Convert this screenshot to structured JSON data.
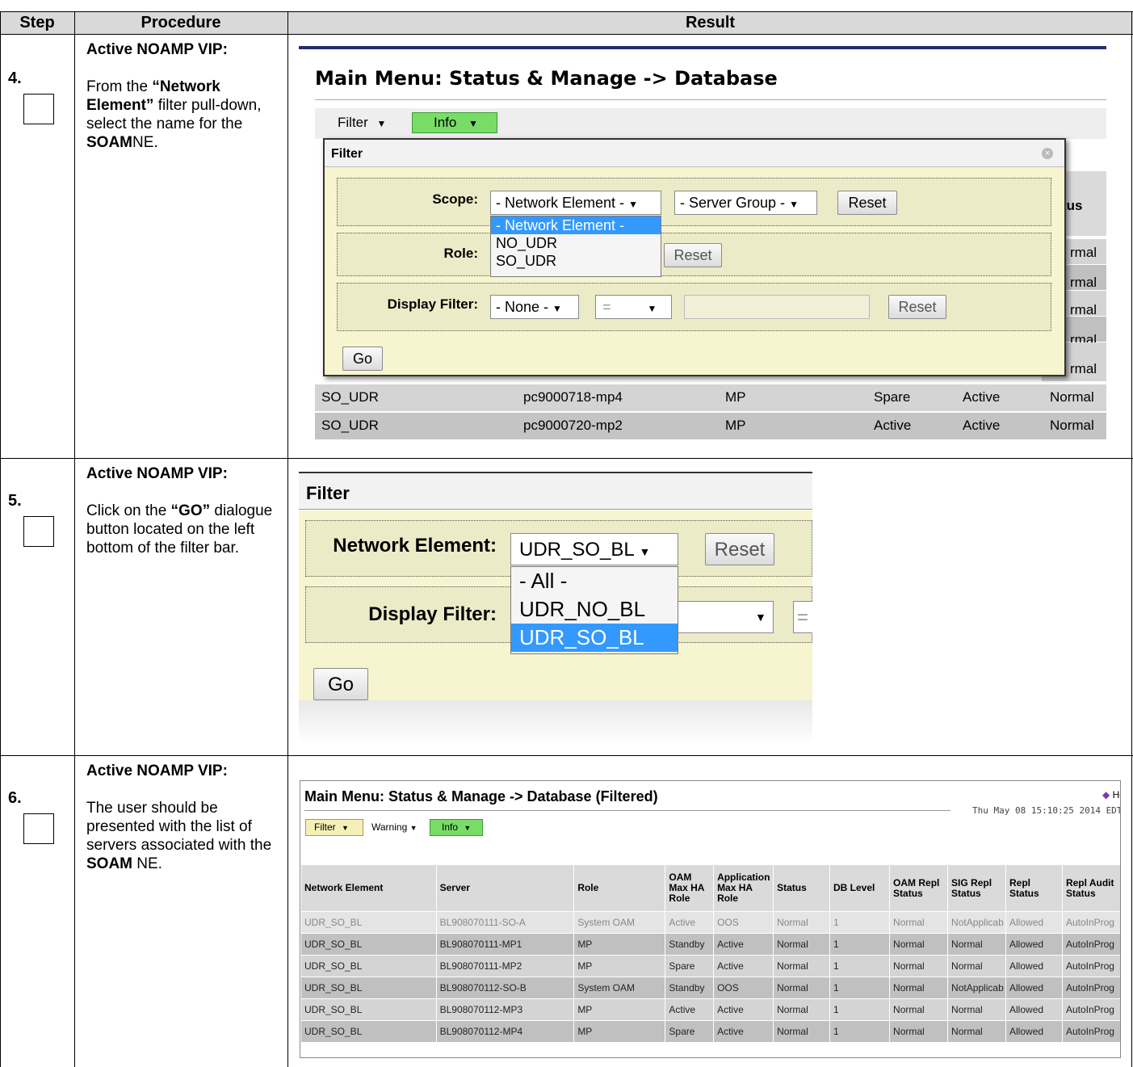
{
  "header": {
    "step": "Step",
    "procedure": "Procedure",
    "result": "Result"
  },
  "steps": [
    {
      "number": "4.",
      "role": "Active NOAMP VIP:",
      "desc_parts": [
        "From the ",
        "“Network Element”",
        " filter pull-down, select the name for the ",
        "SOAM",
        "NE."
      ]
    },
    {
      "number": "5.",
      "role": "Active NOAMP VIP:",
      "desc_parts": [
        "Click on the ",
        "“GO”",
        " dialogue button located on the left bottom of the filter bar."
      ]
    },
    {
      "number": "6.",
      "role": "Active NOAMP VIP:",
      "desc_parts": [
        "The user should be presented with the list of servers associated with the ",
        "SOAM",
        " NE."
      ]
    }
  ],
  "shot1": {
    "title": "Main Menu: Status & Manage -> Database",
    "filter_label": "Filter",
    "info_label": "Info",
    "dialog_title": "Filter",
    "scope_label": "Scope:",
    "ne_select": "- Network Element -",
    "sg_select": "- Server Group -",
    "reset": "Reset",
    "dropdown": [
      "- Network Element -",
      "NO_UDR",
      "SO_UDR"
    ],
    "role_label": "Role:",
    "display_filter_label": "Display Filter:",
    "none_select": "- None -",
    "eq_select": "=",
    "go": "Go",
    "status_fragment": "tus",
    "normal_fragments": [
      "rmal",
      "rmal",
      "rmal",
      "rmal",
      "rmal"
    ],
    "rows": [
      [
        "SO_UDR",
        "pc9000718-mp4",
        "MP",
        "Spare",
        "Active",
        "Normal"
      ],
      [
        "SO_UDR",
        "pc9000720-mp2",
        "MP",
        "Active",
        "Active",
        "Normal"
      ]
    ]
  },
  "shot2": {
    "title": "Filter",
    "ne_label": "Network Element:",
    "ne_value": "UDR_SO_BL",
    "reset": "Reset",
    "dropdown": [
      "- All -",
      "UDR_NO_BL",
      "UDR_SO_BL"
    ],
    "display_filter_label": "Display Filter:",
    "eq_fragment": "=",
    "go": "Go"
  },
  "shot3": {
    "title": "Main Menu: Status & Manage -> Database (Filtered)",
    "help": "Help",
    "timestamp": "Thu May 08 15:10:25 2014 EDT",
    "filter": "Filter",
    "warning": "Warning",
    "info": "Info",
    "columns": [
      "Network Element",
      "Server",
      "Role",
      "OAM Max HA Role",
      "Application Max HA Role",
      "Status",
      "DB Level",
      "OAM Repl Status",
      "SIG Repl Status",
      "Repl Status",
      "Repl Audit Status"
    ],
    "rows": [
      [
        "UDR_SO_BL",
        "BL908070111-SO-A",
        "System OAM",
        "Active",
        "OOS",
        "Normal",
        "1",
        "Normal",
        "NotApplicab",
        "Allowed",
        "AutoInProg"
      ],
      [
        "UDR_SO_BL",
        "BL908070111-MP1",
        "MP",
        "Standby",
        "Active",
        "Normal",
        "1",
        "Normal",
        "Normal",
        "Allowed",
        "AutoInProg"
      ],
      [
        "UDR_SO_BL",
        "BL908070111-MP2",
        "MP",
        "Spare",
        "Active",
        "Normal",
        "1",
        "Normal",
        "Normal",
        "Allowed",
        "AutoInProg"
      ],
      [
        "UDR_SO_BL",
        "BL908070112-SO-B",
        "System OAM",
        "Standby",
        "OOS",
        "Normal",
        "1",
        "Normal",
        "NotApplicab",
        "Allowed",
        "AutoInProg"
      ],
      [
        "UDR_SO_BL",
        "BL908070112-MP3",
        "MP",
        "Active",
        "Active",
        "Normal",
        "1",
        "Normal",
        "Normal",
        "Allowed",
        "AutoInProg"
      ],
      [
        "UDR_SO_BL",
        "BL908070112-MP4",
        "MP",
        "Spare",
        "Active",
        "Normal",
        "1",
        "Normal",
        "Normal",
        "Allowed",
        "AutoInProg"
      ]
    ]
  }
}
